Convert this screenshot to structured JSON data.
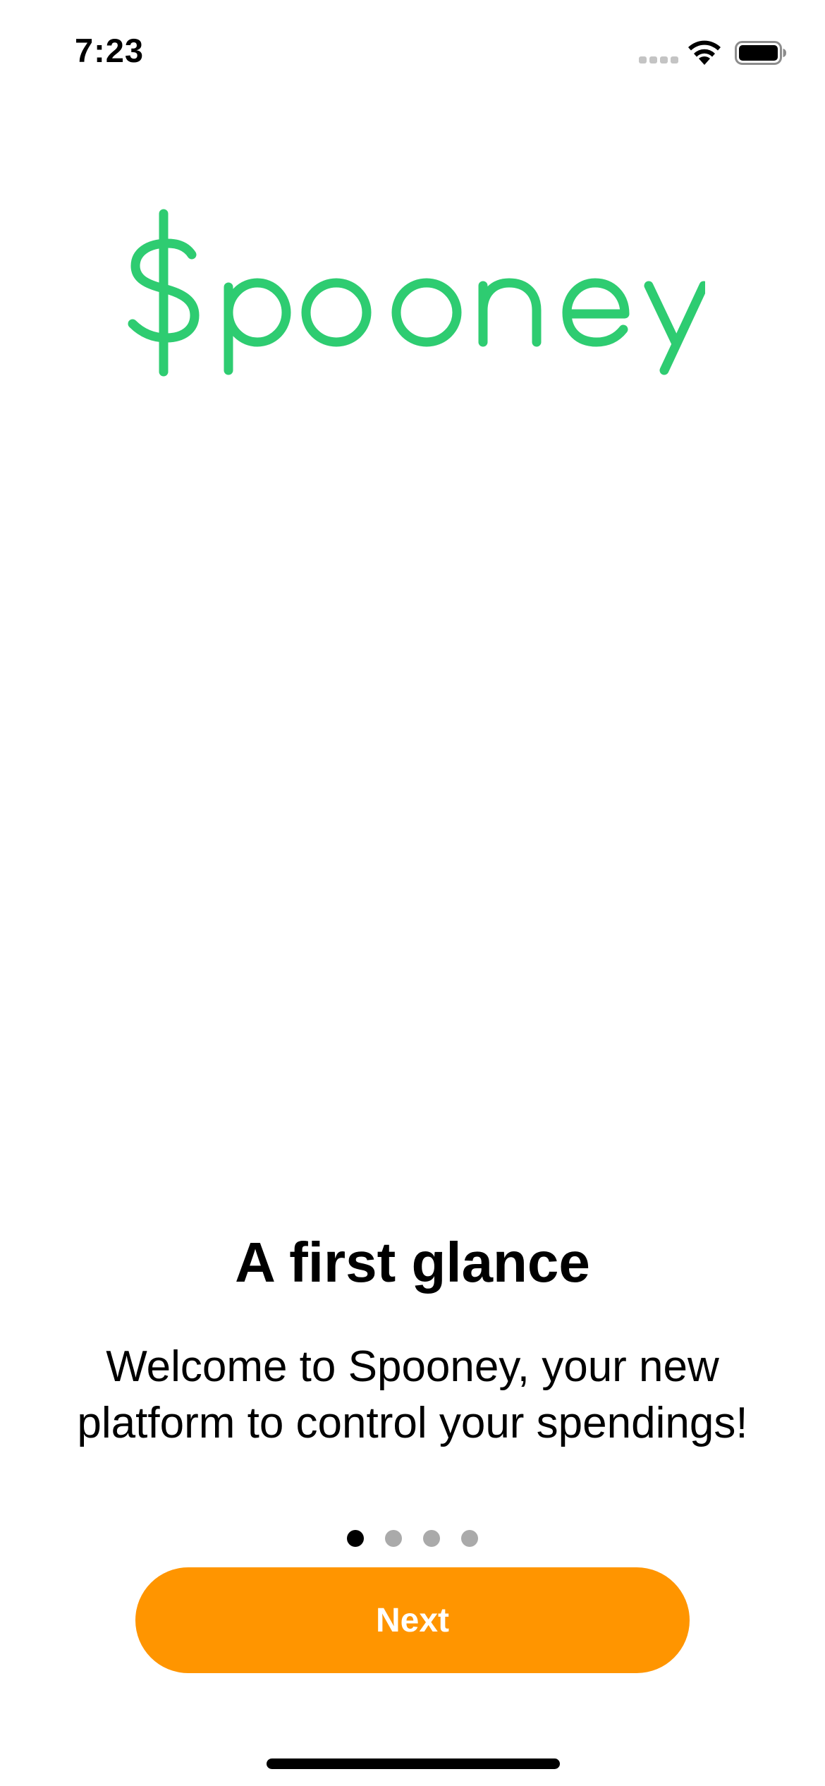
{
  "status_bar": {
    "time": "7:23",
    "icons": [
      "cellular-signal-icon",
      "wifi-icon",
      "battery-icon"
    ]
  },
  "logo": {
    "text": "$pooney",
    "color": "#2ECC71"
  },
  "onboarding": {
    "title": "A first glance",
    "subtitle": "Welcome to Spooney, your new platform to control your spendings!",
    "page_count": 4,
    "current_page": 1
  },
  "next_button": {
    "label": "Next",
    "color": "#FF9500"
  }
}
